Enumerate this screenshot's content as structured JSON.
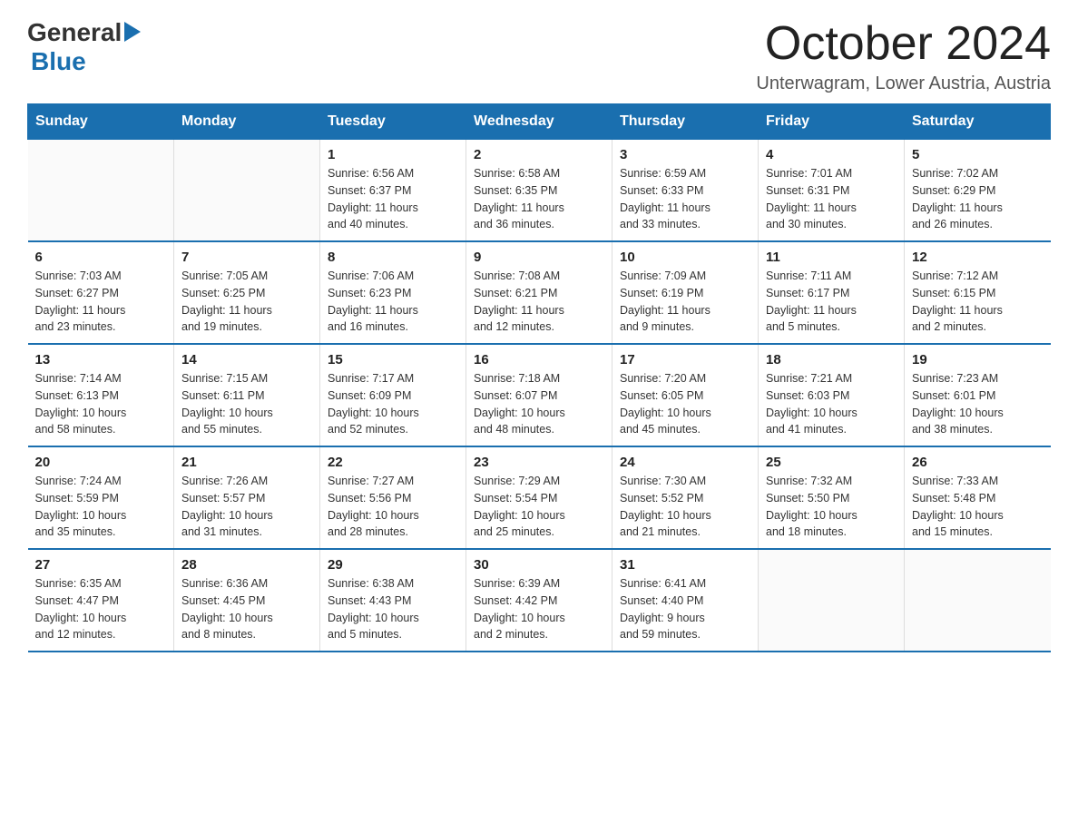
{
  "header": {
    "logo_general": "General",
    "logo_blue": "Blue",
    "title": "October 2024",
    "subtitle": "Unterwagram, Lower Austria, Austria"
  },
  "calendar": {
    "days_of_week": [
      "Sunday",
      "Monday",
      "Tuesday",
      "Wednesday",
      "Thursday",
      "Friday",
      "Saturday"
    ],
    "weeks": [
      [
        {
          "day": "",
          "info": ""
        },
        {
          "day": "",
          "info": ""
        },
        {
          "day": "1",
          "info": "Sunrise: 6:56 AM\nSunset: 6:37 PM\nDaylight: 11 hours\nand 40 minutes."
        },
        {
          "day": "2",
          "info": "Sunrise: 6:58 AM\nSunset: 6:35 PM\nDaylight: 11 hours\nand 36 minutes."
        },
        {
          "day": "3",
          "info": "Sunrise: 6:59 AM\nSunset: 6:33 PM\nDaylight: 11 hours\nand 33 minutes."
        },
        {
          "day": "4",
          "info": "Sunrise: 7:01 AM\nSunset: 6:31 PM\nDaylight: 11 hours\nand 30 minutes."
        },
        {
          "day": "5",
          "info": "Sunrise: 7:02 AM\nSunset: 6:29 PM\nDaylight: 11 hours\nand 26 minutes."
        }
      ],
      [
        {
          "day": "6",
          "info": "Sunrise: 7:03 AM\nSunset: 6:27 PM\nDaylight: 11 hours\nand 23 minutes."
        },
        {
          "day": "7",
          "info": "Sunrise: 7:05 AM\nSunset: 6:25 PM\nDaylight: 11 hours\nand 19 minutes."
        },
        {
          "day": "8",
          "info": "Sunrise: 7:06 AM\nSunset: 6:23 PM\nDaylight: 11 hours\nand 16 minutes."
        },
        {
          "day": "9",
          "info": "Sunrise: 7:08 AM\nSunset: 6:21 PM\nDaylight: 11 hours\nand 12 minutes."
        },
        {
          "day": "10",
          "info": "Sunrise: 7:09 AM\nSunset: 6:19 PM\nDaylight: 11 hours\nand 9 minutes."
        },
        {
          "day": "11",
          "info": "Sunrise: 7:11 AM\nSunset: 6:17 PM\nDaylight: 11 hours\nand 5 minutes."
        },
        {
          "day": "12",
          "info": "Sunrise: 7:12 AM\nSunset: 6:15 PM\nDaylight: 11 hours\nand 2 minutes."
        }
      ],
      [
        {
          "day": "13",
          "info": "Sunrise: 7:14 AM\nSunset: 6:13 PM\nDaylight: 10 hours\nand 58 minutes."
        },
        {
          "day": "14",
          "info": "Sunrise: 7:15 AM\nSunset: 6:11 PM\nDaylight: 10 hours\nand 55 minutes."
        },
        {
          "day": "15",
          "info": "Sunrise: 7:17 AM\nSunset: 6:09 PM\nDaylight: 10 hours\nand 52 minutes."
        },
        {
          "day": "16",
          "info": "Sunrise: 7:18 AM\nSunset: 6:07 PM\nDaylight: 10 hours\nand 48 minutes."
        },
        {
          "day": "17",
          "info": "Sunrise: 7:20 AM\nSunset: 6:05 PM\nDaylight: 10 hours\nand 45 minutes."
        },
        {
          "day": "18",
          "info": "Sunrise: 7:21 AM\nSunset: 6:03 PM\nDaylight: 10 hours\nand 41 minutes."
        },
        {
          "day": "19",
          "info": "Sunrise: 7:23 AM\nSunset: 6:01 PM\nDaylight: 10 hours\nand 38 minutes."
        }
      ],
      [
        {
          "day": "20",
          "info": "Sunrise: 7:24 AM\nSunset: 5:59 PM\nDaylight: 10 hours\nand 35 minutes."
        },
        {
          "day": "21",
          "info": "Sunrise: 7:26 AM\nSunset: 5:57 PM\nDaylight: 10 hours\nand 31 minutes."
        },
        {
          "day": "22",
          "info": "Sunrise: 7:27 AM\nSunset: 5:56 PM\nDaylight: 10 hours\nand 28 minutes."
        },
        {
          "day": "23",
          "info": "Sunrise: 7:29 AM\nSunset: 5:54 PM\nDaylight: 10 hours\nand 25 minutes."
        },
        {
          "day": "24",
          "info": "Sunrise: 7:30 AM\nSunset: 5:52 PM\nDaylight: 10 hours\nand 21 minutes."
        },
        {
          "day": "25",
          "info": "Sunrise: 7:32 AM\nSunset: 5:50 PM\nDaylight: 10 hours\nand 18 minutes."
        },
        {
          "day": "26",
          "info": "Sunrise: 7:33 AM\nSunset: 5:48 PM\nDaylight: 10 hours\nand 15 minutes."
        }
      ],
      [
        {
          "day": "27",
          "info": "Sunrise: 6:35 AM\nSunset: 4:47 PM\nDaylight: 10 hours\nand 12 minutes."
        },
        {
          "day": "28",
          "info": "Sunrise: 6:36 AM\nSunset: 4:45 PM\nDaylight: 10 hours\nand 8 minutes."
        },
        {
          "day": "29",
          "info": "Sunrise: 6:38 AM\nSunset: 4:43 PM\nDaylight: 10 hours\nand 5 minutes."
        },
        {
          "day": "30",
          "info": "Sunrise: 6:39 AM\nSunset: 4:42 PM\nDaylight: 10 hours\nand 2 minutes."
        },
        {
          "day": "31",
          "info": "Sunrise: 6:41 AM\nSunset: 4:40 PM\nDaylight: 9 hours\nand 59 minutes."
        },
        {
          "day": "",
          "info": ""
        },
        {
          "day": "",
          "info": ""
        }
      ]
    ]
  }
}
